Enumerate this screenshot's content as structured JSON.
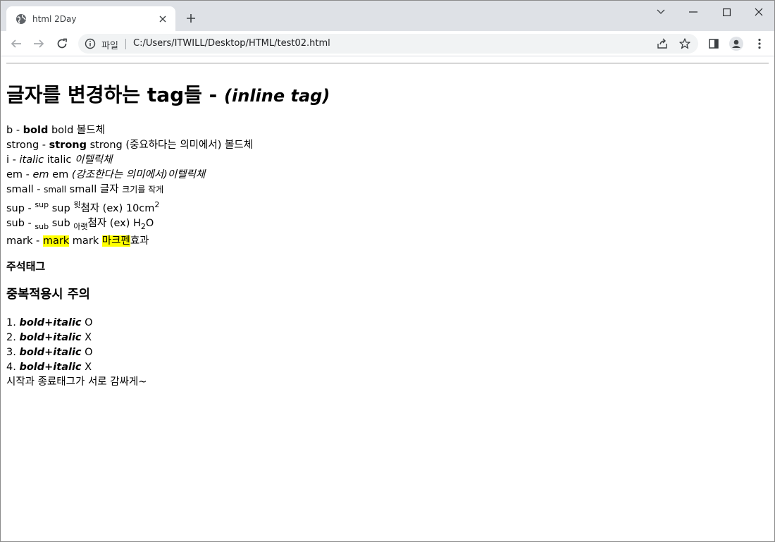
{
  "browser": {
    "tab_title": "html 2Day",
    "site_label": "파일",
    "url": "C:/Users/ITWILL/Desktop/HTML/test02.html"
  },
  "page": {
    "heading": "글자를 변경하는 tag들 - ",
    "heading_em": "(inline tag)",
    "lines": {
      "b": {
        "prefix": "b - ",
        "strong": "bold",
        "plain": " bold 볼드체"
      },
      "strong": {
        "prefix": "strong - ",
        "strong": "strong",
        "plain": " strong (중요하다는 의미에서) 볼드체"
      },
      "i": {
        "prefix": "i - ",
        "em": "italic",
        "plain": " italic ",
        "em2": "이텔릭체"
      },
      "em": {
        "prefix": "em - ",
        "em": "em",
        "plain": " em ",
        "em2": "(강조한다는 의미에서)이텔릭체"
      },
      "small": {
        "prefix": "small - ",
        "small": "small",
        "plain": " small 글자 ",
        "small2": "크기를 작게"
      },
      "sup": {
        "prefix": "sup - ",
        "sup": "sup",
        "plain": " sup ",
        "sup2": "윗",
        "plain2": "첨자 (ex) 10cm",
        "sup3": "2"
      },
      "sub": {
        "prefix": "sub - ",
        "sub": "sub",
        "plain": " sub ",
        "sub2": "아랫",
        "plain2": "첨자 (ex) H",
        "sub3": "2",
        "plain3": "O"
      },
      "mark": {
        "prefix": "mark - ",
        "mark": "mark",
        "plain": " mark ",
        "mark2": "마크펜",
        "plain2": "효과"
      }
    },
    "comment_heading": "주석태그",
    "nesting_heading": "중복적용시 주의",
    "items": [
      {
        "num": "1. ",
        "text": "bold+italic",
        "result": " O"
      },
      {
        "num": "2. ",
        "text": "bold+italic",
        "result": " X"
      },
      {
        "num": "3. ",
        "text": "bold+italic",
        "result": " O"
      },
      {
        "num": "4. ",
        "text": "bold+italic",
        "result": " X"
      }
    ],
    "footer_line": "시작과 종료태그가 서로 감싸게~"
  },
  "colors": {
    "highlight": "#ffff00",
    "tabstrip": "#dee1e6",
    "omnibox": "#f1f3f4"
  }
}
